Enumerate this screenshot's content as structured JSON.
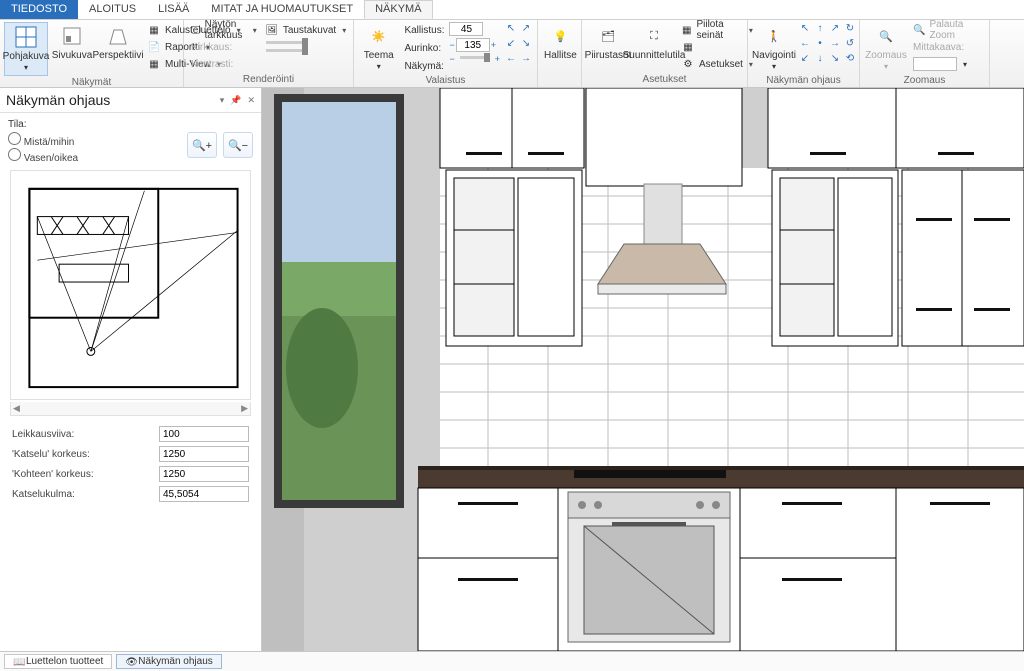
{
  "tabs": {
    "file": "TIEDOSTO",
    "home": "ALOITUS",
    "insert": "LISÄÄ",
    "measure": "MITAT JA HUOMAUTUKSET",
    "view": "NÄKYMÄ"
  },
  "ribbon": {
    "views": {
      "plan": "Pohjakuva",
      "side": "Sivukuva",
      "persp": "Perspektiivi",
      "catalog": "Kalusteluettelo",
      "report": "Raportti",
      "multi": "Multi-View",
      "label": "Näkymät"
    },
    "render": {
      "quality": "Näytön tarkkuus",
      "bg": "Taustakuvat",
      "bright": "Kirkkaus:",
      "contrast": "Kontrasti:",
      "label": "Renderöinti"
    },
    "light": {
      "theme": "Teema",
      "tilt": "Kallistus:",
      "sun": "Aurinko:",
      "view": "Näkymä:",
      "tilt_val": "45",
      "sun_val": "135",
      "label": "Valaistus"
    },
    "manage": {
      "btn": "Hallitse"
    },
    "settings": {
      "layers": "Piirustasot",
      "design": "Suunnittelutila",
      "walls": "Piilota seinät",
      "opts": "Asetukset",
      "label": "Asetukset"
    },
    "nav": {
      "btn": "Navigointi",
      "label": "Näkymän ohjaus"
    },
    "zoom": {
      "btn": "Zoomaus",
      "reset": "Palauta Zoom",
      "scale": "Mittakaava:",
      "label": "Zoomaus"
    }
  },
  "panel": {
    "title": "Näkymän ohjaus",
    "mode_label": "Tila:",
    "mode1": "Mistä/mihin",
    "mode2": "Vasen/oikea",
    "f1_label": "Leikkausviiva:",
    "f1_val": "100",
    "f2_label": "'Katselu' korkeus:",
    "f2_val": "1250",
    "f3_label": "'Kohteen' korkeus:",
    "f3_val": "1250",
    "f4_label": "Katselukulma:",
    "f4_val": "45,5054"
  },
  "bottom": {
    "t1": "Luettelon tuotteet",
    "t2": "Näkymän ohjaus"
  }
}
